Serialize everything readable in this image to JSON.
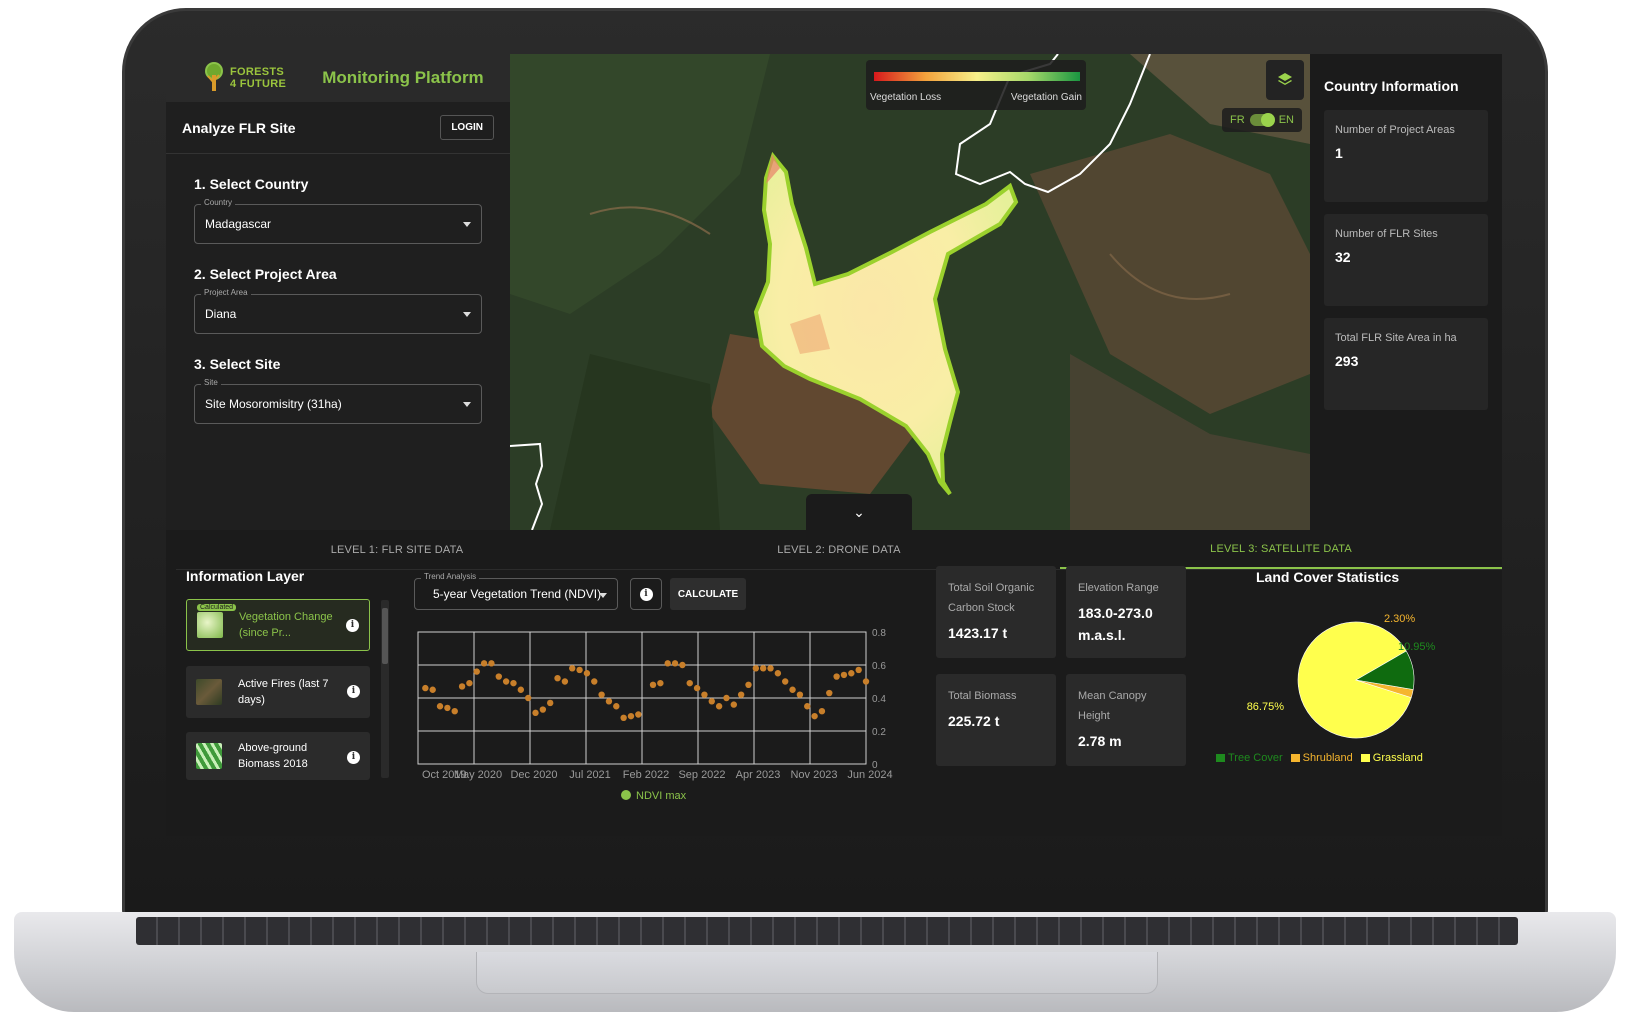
{
  "brand": {
    "logo_line1": "FORESTS",
    "logo_line2": "4 FUTURE",
    "title": "Monitoring Platform"
  },
  "sidebar": {
    "heading": "Analyze FLR Site",
    "login_label": "LOGIN",
    "steps": [
      {
        "title": "1. Select Country",
        "field_label": "Country",
        "value": "Madagascar"
      },
      {
        "title": "2. Select Project Area",
        "field_label": "Project Area",
        "value": "Diana"
      },
      {
        "title": "3. Select Site",
        "field_label": "Site",
        "value": "Site Mosoromisitry (31ha)"
      }
    ]
  },
  "map": {
    "legend_loss": "Vegetation Loss",
    "legend_gain": "Vegetation Gain",
    "lang_fr": "FR",
    "lang_en": "EN",
    "collapse_icon": "chevron-double-down-icon",
    "layers_icon": "layers-icon"
  },
  "country_info": {
    "title": "Country Information",
    "cards": [
      {
        "label": "Number of Project Areas",
        "value": "1"
      },
      {
        "label": "Number of FLR Sites",
        "value": "32"
      },
      {
        "label": "Total FLR Site Area in ha",
        "value": "293"
      }
    ]
  },
  "tabs": [
    {
      "label": "LEVEL 1: FLR SITE DATA",
      "active": false
    },
    {
      "label": "LEVEL 2: DRONE DATA",
      "active": false
    },
    {
      "label": "LEVEL 3: SATELLITE DATA",
      "active": true
    }
  ],
  "info_layer": {
    "title": "Information Layer",
    "items": [
      {
        "label": "Vegetation Change (since Pr...",
        "badge": "Calculated",
        "active": true
      },
      {
        "label": "Active Fires (last 7 days)",
        "active": false
      },
      {
        "label": "Above-ground Biomass 2018",
        "active": false
      }
    ]
  },
  "trend": {
    "field_label": "Trend Analysis",
    "value": "5-year Vegetation Trend (NDVI)",
    "calculate_label": "CALCULATE",
    "legend": "NDVI max"
  },
  "chart_data": [
    {
      "type": "scatter",
      "title": "",
      "xlabel": "",
      "ylabel": "",
      "x_tick_labels": [
        "Oct 2019",
        "May 2020",
        "Dec 2020",
        "Jul 2021",
        "Feb 2022",
        "Sep 2022",
        "Apr 2023",
        "Nov 2023",
        "Jun 2024"
      ],
      "y_ticks": [
        0,
        0.2,
        0.4,
        0.6,
        0.8
      ],
      "ylim": [
        0,
        0.8
      ],
      "grid": true,
      "legend_position": "bottom",
      "series": [
        {
          "name": "NDVI max",
          "color": "#c87f2a",
          "points": [
            {
              "x": "2019-10",
              "y": 0.46
            },
            {
              "x": "2019-11",
              "y": 0.45
            },
            {
              "x": "2019-12",
              "y": 0.35
            },
            {
              "x": "2020-01",
              "y": 0.34
            },
            {
              "x": "2020-02",
              "y": 0.32
            },
            {
              "x": "2020-03",
              "y": 0.47
            },
            {
              "x": "2020-04",
              "y": 0.49
            },
            {
              "x": "2020-05",
              "y": 0.56
            },
            {
              "x": "2020-06",
              "y": 0.61
            },
            {
              "x": "2020-07",
              "y": 0.61
            },
            {
              "x": "2020-08",
              "y": 0.53
            },
            {
              "x": "2020-09",
              "y": 0.5
            },
            {
              "x": "2020-10",
              "y": 0.49
            },
            {
              "x": "2020-11",
              "y": 0.45
            },
            {
              "x": "2020-12",
              "y": 0.4
            },
            {
              "x": "2021-01",
              "y": 0.31
            },
            {
              "x": "2021-02",
              "y": 0.33
            },
            {
              "x": "2021-03",
              "y": 0.37
            },
            {
              "x": "2021-04",
              "y": 0.52
            },
            {
              "x": "2021-05",
              "y": 0.5
            },
            {
              "x": "2021-06",
              "y": 0.58
            },
            {
              "x": "2021-07",
              "y": 0.57
            },
            {
              "x": "2021-08",
              "y": 0.55
            },
            {
              "x": "2021-09",
              "y": 0.5
            },
            {
              "x": "2021-10",
              "y": 0.42
            },
            {
              "x": "2021-11",
              "y": 0.38
            },
            {
              "x": "2021-12",
              "y": 0.35
            },
            {
              "x": "2022-01",
              "y": 0.28
            },
            {
              "x": "2022-02",
              "y": 0.29
            },
            {
              "x": "2022-03",
              "y": 0.3
            },
            {
              "x": "2022-05",
              "y": 0.48
            },
            {
              "x": "2022-06",
              "y": 0.49
            },
            {
              "x": "2022-07",
              "y": 0.61
            },
            {
              "x": "2022-08",
              "y": 0.61
            },
            {
              "x": "2022-09",
              "y": 0.6
            },
            {
              "x": "2022-10",
              "y": 0.49
            },
            {
              "x": "2022-11",
              "y": 0.46
            },
            {
              "x": "2022-12",
              "y": 0.42
            },
            {
              "x": "2023-01",
              "y": 0.38
            },
            {
              "x": "2023-02",
              "y": 0.35
            },
            {
              "x": "2023-03",
              "y": 0.4
            },
            {
              "x": "2023-04",
              "y": 0.36
            },
            {
              "x": "2023-05",
              "y": 0.42
            },
            {
              "x": "2023-06",
              "y": 0.48
            },
            {
              "x": "2023-07",
              "y": 0.58
            },
            {
              "x": "2023-08",
              "y": 0.58
            },
            {
              "x": "2023-09",
              "y": 0.58
            },
            {
              "x": "2023-10",
              "y": 0.55
            },
            {
              "x": "2023-11",
              "y": 0.5
            },
            {
              "x": "2023-12",
              "y": 0.45
            },
            {
              "x": "2024-01",
              "y": 0.42
            },
            {
              "x": "2024-02",
              "y": 0.35
            },
            {
              "x": "2024-03",
              "y": 0.29
            },
            {
              "x": "2024-04",
              "y": 0.32
            },
            {
              "x": "2024-05",
              "y": 0.43
            },
            {
              "x": "2024-06",
              "y": 0.53
            },
            {
              "x": "2024-07",
              "y": 0.54
            },
            {
              "x": "2024-08",
              "y": 0.55
            },
            {
              "x": "2024-09",
              "y": 0.57
            },
            {
              "x": "2024-10",
              "y": 0.5
            }
          ]
        }
      ]
    },
    {
      "type": "pie",
      "title": "Land Cover Statistics",
      "slices": [
        {
          "label": "Grassland",
          "value": 86.75,
          "display": "86.75%",
          "color": "#ffff4d"
        },
        {
          "label": "Shrubland",
          "value": 2.3,
          "display": "2.30%",
          "color": "#f5b52e"
        },
        {
          "label": "Tree Cover",
          "value": 10.95,
          "display": "10.95%",
          "color": "#0f6b0f"
        }
      ],
      "legend_position": "bottom"
    }
  ],
  "stats": [
    {
      "label": "Total Soil Organic Carbon Stock",
      "value": "1423.17 t"
    },
    {
      "label": "Elevation Range",
      "value": "183.0-273.0 m.a.s.l."
    },
    {
      "label": "Total Biomass",
      "value": "225.72 t"
    },
    {
      "label": "Mean Canopy Height",
      "value": "2.78 m"
    }
  ],
  "land_cover": {
    "title": "Land Cover Statistics",
    "legend": [
      "Tree Cover",
      "Shrubland",
      "Grassland"
    ],
    "legend_colors": [
      "#1e8a1e",
      "#f5b52e",
      "#ffff4d"
    ]
  }
}
